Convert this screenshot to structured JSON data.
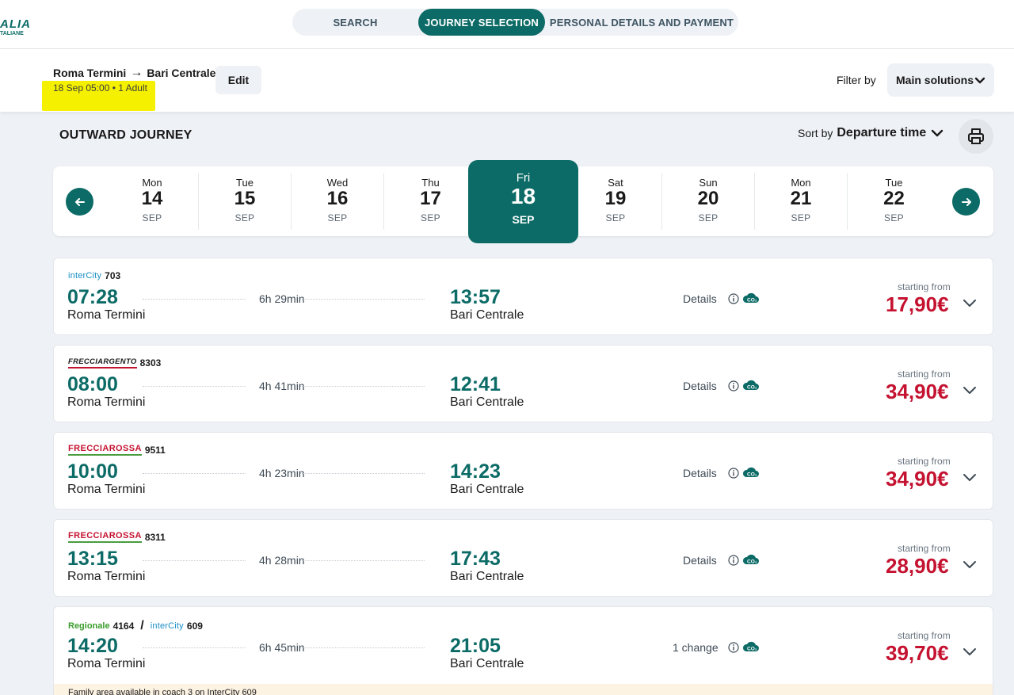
{
  "logo": {
    "line1": "ALIA",
    "line2": "TALIANE"
  },
  "steps": [
    "SEARCH",
    "JOURNEY SELECTION",
    "PERSONAL DETAILS AND PAYMENT"
  ],
  "summary": {
    "from": "Roma Termini",
    "to": "Bari Centrale",
    "arrow": "→",
    "sub": "18 Sep 05:00 • 1 Adult",
    "edit_label": "Edit",
    "filter_label": "Filter by",
    "filter_value": "Main solutions"
  },
  "outward": {
    "title": "OUTWARD JOURNEY",
    "sort_label": "Sort by",
    "sort_value": "Departure time"
  },
  "days": [
    {
      "name": "Mon",
      "num": "14",
      "month": "SEP"
    },
    {
      "name": "Tue",
      "num": "15",
      "month": "SEP"
    },
    {
      "name": "Wed",
      "num": "16",
      "month": "SEP"
    },
    {
      "name": "Thu",
      "num": "17",
      "month": "SEP"
    },
    {
      "name": "Fri",
      "num": "18",
      "month": "SEP"
    },
    {
      "name": "Sat",
      "num": "19",
      "month": "SEP"
    },
    {
      "name": "Sun",
      "num": "20",
      "month": "SEP"
    },
    {
      "name": "Mon",
      "num": "21",
      "month": "SEP"
    },
    {
      "name": "Tue",
      "num": "22",
      "month": "SEP"
    }
  ],
  "selected_day_index": 4,
  "journeys": [
    {
      "brand1": "interCity",
      "num1": "703",
      "dep": "07:28",
      "dep_station": "Roma Termini",
      "duration": "6h 29min",
      "arr": "13:57",
      "arr_station": "Bari Centrale",
      "details": "Details",
      "from_label": "starting from",
      "price": "17,90€"
    },
    {
      "brand1": "FRECCIARGENTO",
      "num1": "8303",
      "dep": "08:00",
      "dep_station": "Roma Termini",
      "duration": "4h 41min",
      "arr": "12:41",
      "arr_station": "Bari Centrale",
      "details": "Details",
      "from_label": "starting from",
      "price": "34,90€"
    },
    {
      "brand1": "FRECCIAROSSA",
      "num1": "9511",
      "dep": "10:00",
      "dep_station": "Roma Termini",
      "duration": "4h 23min",
      "arr": "14:23",
      "arr_station": "Bari Centrale",
      "details": "Details",
      "from_label": "starting from",
      "price": "34,90€"
    },
    {
      "brand1": "FRECCIAROSSA",
      "num1": "8311",
      "dep": "13:15",
      "dep_station": "Roma Termini",
      "duration": "4h 28min",
      "arr": "17:43",
      "arr_station": "Bari Centrale",
      "details": "Details",
      "from_label": "starting from",
      "price": "28,90€"
    },
    {
      "brand1": "Regionale",
      "num1": "4164",
      "separator": "/",
      "brand2": "interCity",
      "num2": "609",
      "dep": "14:20",
      "dep_station": "Roma Termini",
      "duration": "6h 45min",
      "arr": "21:05",
      "arr_station": "Bari Centrale",
      "details": "1 change",
      "from_label": "starting from",
      "price": "39,70€",
      "notice": "Family area available in coach 3 on InterCity 609"
    }
  ],
  "colors": {
    "brand_green": "#0c6b66",
    "price_red": "#c41230",
    "highlight": "#f4f000"
  }
}
